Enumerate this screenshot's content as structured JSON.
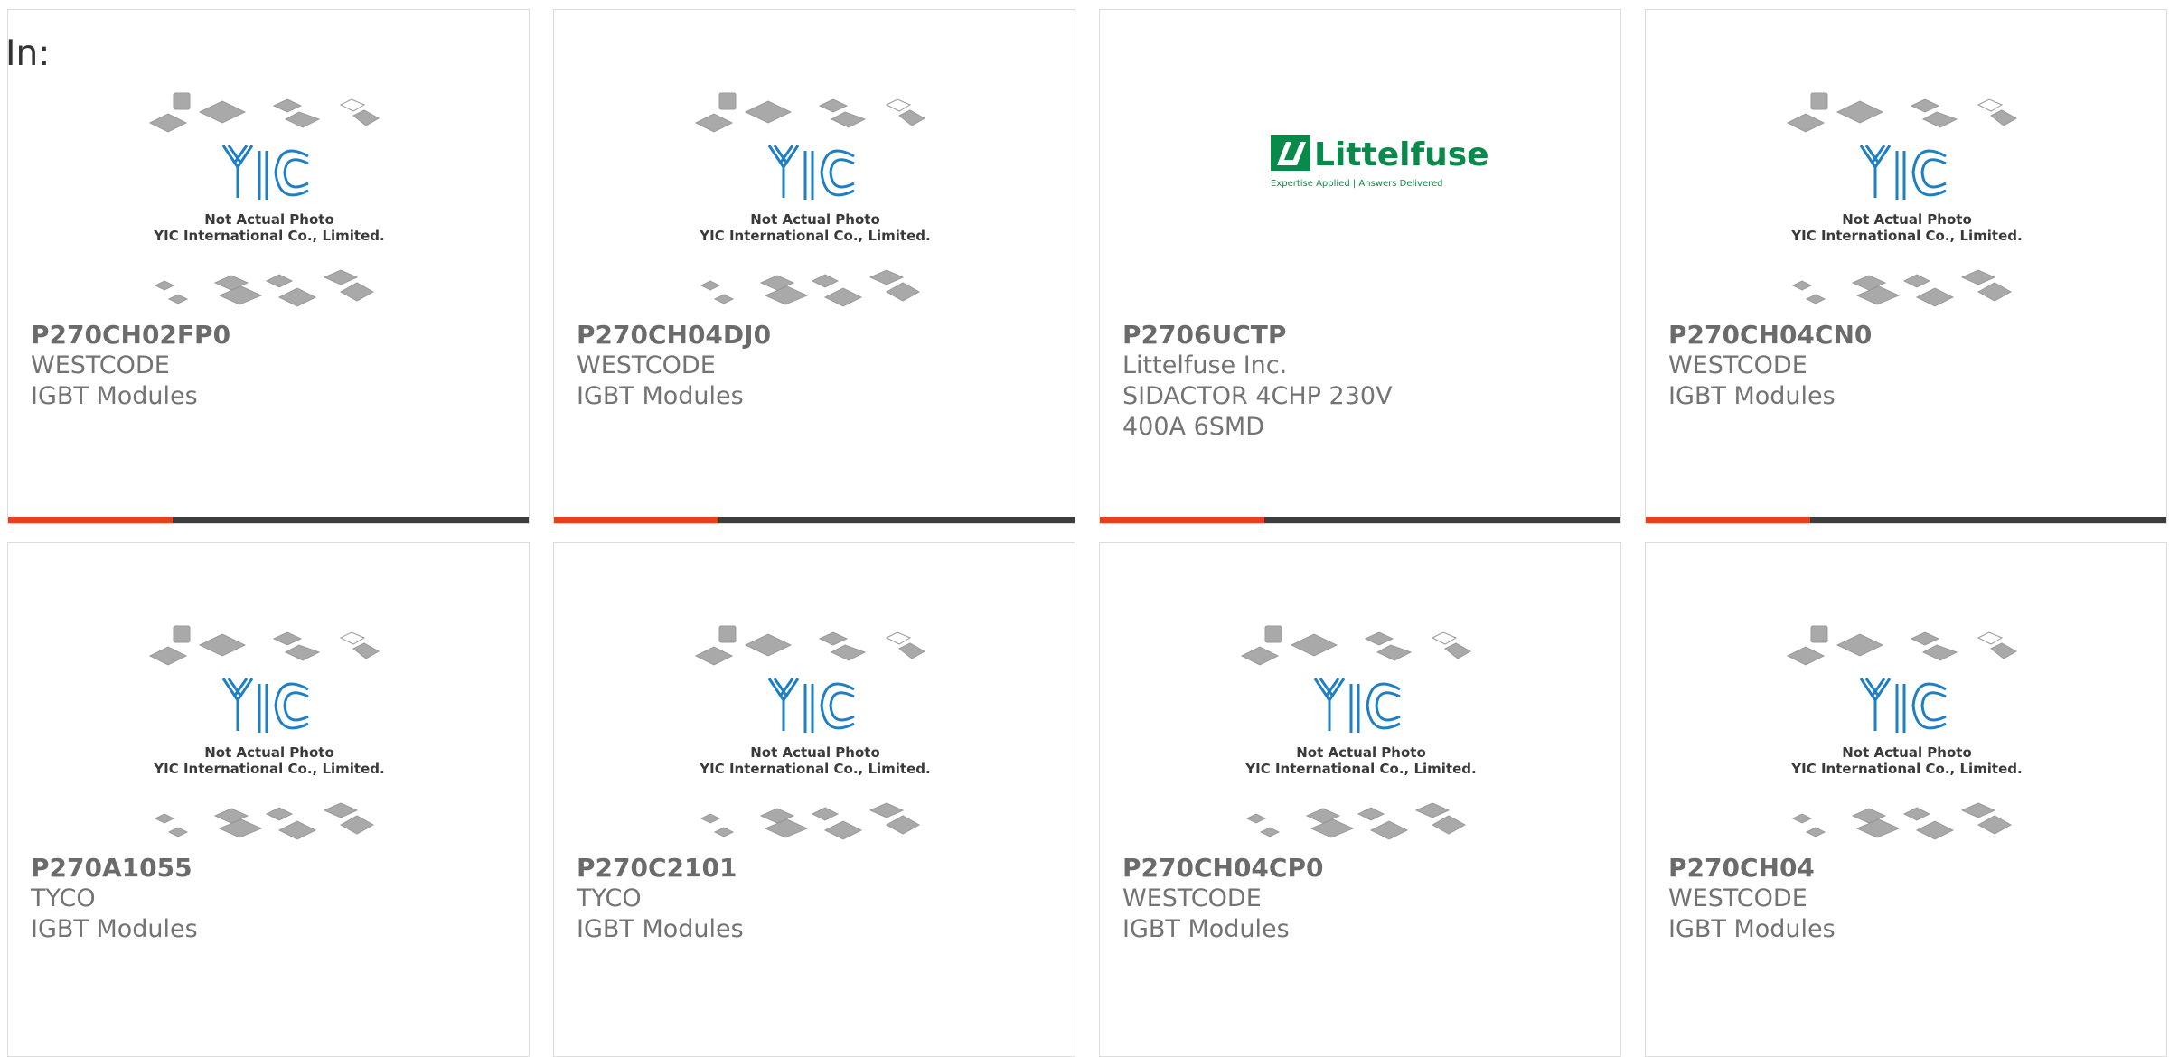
{
  "filter_label": "In:",
  "placeholder": {
    "line1": "Not Actual Photo",
    "line2": "YIC International Co., Limited."
  },
  "littelfuse_logo": {
    "brand": "Littelfuse",
    "tagline": "Expertise Applied | Answers Delivered"
  },
  "colors": {
    "accent_bar": "#e8401c",
    "bar": "#3d3d3d",
    "yic_logo": "#1e7fc4",
    "littelfuse_green": "#0a8a4a"
  },
  "products": [
    {
      "part_number": "P270CH02FP0",
      "manufacturer": "WESTCODE",
      "description": "IGBT Modules",
      "image": "yic-placeholder"
    },
    {
      "part_number": "P270CH04DJ0",
      "manufacturer": "WESTCODE",
      "description": "IGBT Modules",
      "image": "yic-placeholder"
    },
    {
      "part_number": "P2706UCTP",
      "manufacturer": "Littelfuse Inc.",
      "description": "SIDACTOR 4CHP 230V 400A 6SMD",
      "image": "littelfuse-logo"
    },
    {
      "part_number": "P270CH04CN0",
      "manufacturer": "WESTCODE",
      "description": "IGBT Modules",
      "image": "yic-placeholder"
    },
    {
      "part_number": "P270A1055",
      "manufacturer": "TYCO",
      "description": "IGBT Modules",
      "image": "yic-placeholder"
    },
    {
      "part_number": "P270C2101",
      "manufacturer": "TYCO",
      "description": "IGBT Modules",
      "image": "yic-placeholder"
    },
    {
      "part_number": "P270CH04CP0",
      "manufacturer": "WESTCODE",
      "description": "IGBT Modules",
      "image": "yic-placeholder"
    },
    {
      "part_number": "P270CH04",
      "manufacturer": "WESTCODE",
      "description": "IGBT Modules",
      "image": "yic-placeholder"
    }
  ]
}
